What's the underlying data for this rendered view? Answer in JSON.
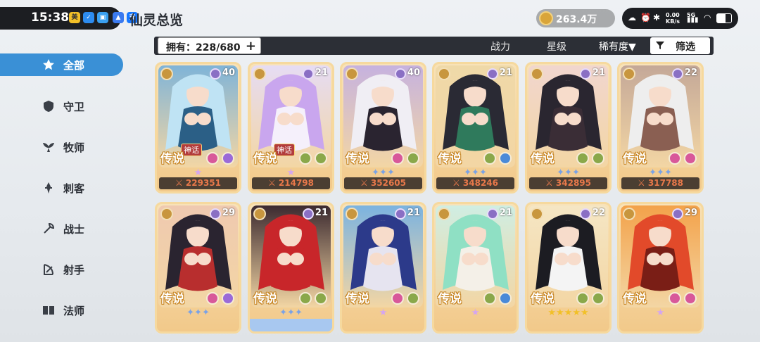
{
  "status": {
    "time": "15:38",
    "page_title": "仙灵总览",
    "currency": "263.4万",
    "net_speed": "0.00",
    "net_unit": "KB/s",
    "signal": "5G"
  },
  "toolbar": {
    "owned_label": "拥有：228/680",
    "sort_power": "战力",
    "sort_star": "星级",
    "sort_rarity": "稀有度▼",
    "filter_label": "筛选"
  },
  "sidebar": {
    "items": [
      {
        "label": "全部",
        "icon": "star-icon",
        "active": true
      },
      {
        "label": "守卫",
        "icon": "shield-icon"
      },
      {
        "label": "牧师",
        "icon": "wings-icon"
      },
      {
        "label": "刺客",
        "icon": "dagger-icon"
      },
      {
        "label": "战士",
        "icon": "axe-icon"
      },
      {
        "label": "射手",
        "icon": "bow-icon"
      },
      {
        "label": "法师",
        "icon": "book-icon"
      }
    ]
  },
  "cards": [
    {
      "level": "40",
      "rarity": "传说",
      "badge": "神话",
      "stars": "★",
      "power": "229351",
      "hair": "#bfe3f4",
      "bg": "#7fb4d8",
      "accent": "#2b5f86"
    },
    {
      "level": "21",
      "rarity": "传说",
      "badge": "神话",
      "stars": "★",
      "power": "214798",
      "hair": "#c9a6ee",
      "bg": "#e6dcf4",
      "accent": "#f5f0fb"
    },
    {
      "level": "40",
      "rarity": "传说",
      "badge": "",
      "stars": "✦✦✦",
      "power": "352605",
      "hair": "#f0eef4",
      "bg": "#c6b2df",
      "accent": "#2a2430"
    },
    {
      "level": "21",
      "rarity": "传说",
      "badge": "",
      "stars": "✦✦✦",
      "power": "348246",
      "hair": "#2a2a34",
      "bg": "#efd9a8",
      "accent": "#2f7a5c"
    },
    {
      "level": "21",
      "rarity": "传说",
      "badge": "",
      "stars": "✦✦✦",
      "power": "342895",
      "hair": "#2a2630",
      "bg": "#f1d6cf",
      "accent": "#3a2d36"
    },
    {
      "level": "22",
      "rarity": "传说",
      "badge": "",
      "stars": "✦✦✦",
      "power": "317788",
      "hair": "#eeeeee",
      "bg": "#c4a898",
      "accent": "#8a5f52"
    },
    {
      "level": "29",
      "rarity": "传说",
      "badge": "",
      "stars": "✦✦✦",
      "power": "",
      "hair": "#2a2430",
      "bg": "#efc9b0",
      "accent": "#b82e2e"
    },
    {
      "level": "21",
      "rarity": "传说",
      "badge": "",
      "stars": "✦✦✦",
      "power": "",
      "hair": "#c8262a",
      "bg": "#3c2a30",
      "accent": "#c8262a"
    },
    {
      "level": "21",
      "rarity": "传说",
      "badge": "",
      "stars": "★",
      "power": "",
      "hair": "#2c3a8a",
      "bg": "#7bb3e0",
      "accent": "#e6e4f0"
    },
    {
      "level": "21",
      "rarity": "传说",
      "badge": "",
      "stars": "★",
      "power": "",
      "hair": "#8fe0c4",
      "bg": "#cfeee3",
      "accent": "#f4f0e8"
    },
    {
      "level": "22",
      "rarity": "传说",
      "badge": "",
      "stars": "★★★★★",
      "power": "",
      "hair": "#1c1c22",
      "bg": "#f5e6c4",
      "accent": "#f4f4f4"
    },
    {
      "level": "29",
      "rarity": "传说",
      "badge": "",
      "stars": "★",
      "power": "",
      "hair": "#e24a2a",
      "bg": "#f3a24a",
      "accent": "#7a1e16"
    }
  ],
  "colors": {
    "sidebar_active": "#3a90d6",
    "toolbar_bg": "#2c2f36",
    "power_text": "#e8784a"
  }
}
